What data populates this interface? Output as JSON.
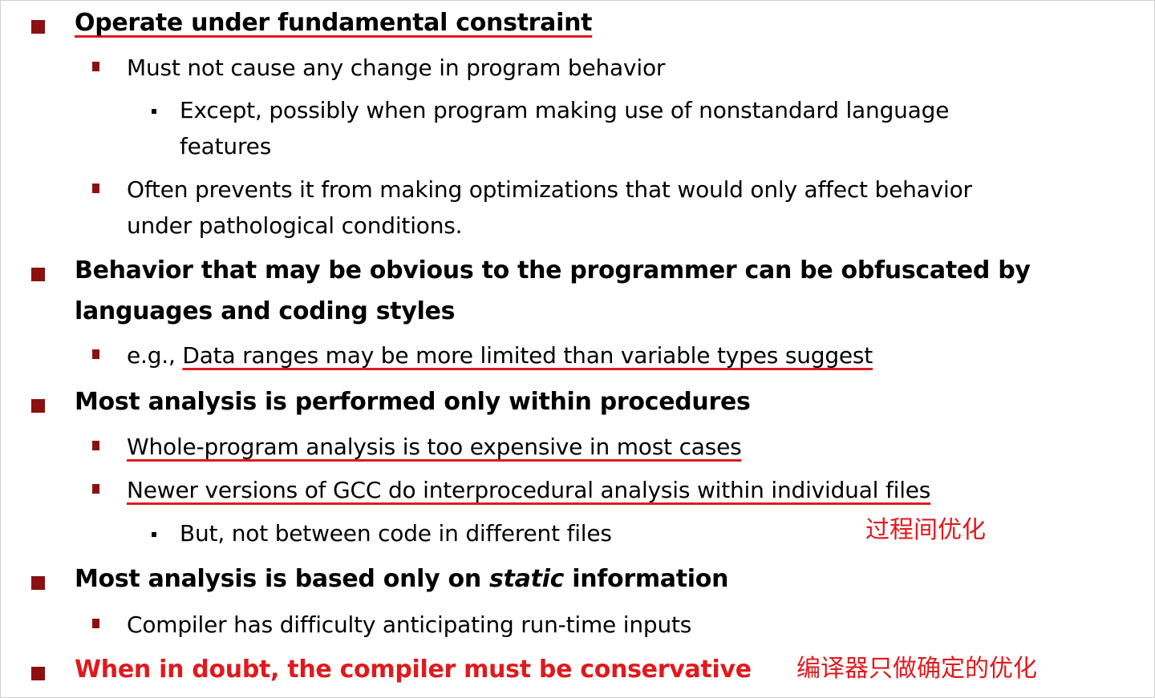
{
  "items": [
    {
      "level": 1,
      "text": "Operate under fundamental constraint"
    },
    {
      "level": 2,
      "text": "Must not cause any change in program behavior"
    },
    {
      "level": 3,
      "text": "Except, possibly when program making use of nonstandard language",
      "cont": "features"
    },
    {
      "level": 2,
      "text": "Often prevents it from making optimizations that would only affect behavior",
      "cont": "under pathological conditions."
    },
    {
      "level": 1,
      "text": "Behavior that may be obvious to the programmer can  be obfuscated by",
      "cont": "languages and coding styles"
    },
    {
      "level": 2,
      "prefix": "e.g., ",
      "text": "Data ranges may be more limited than variable types suggest"
    },
    {
      "level": 1,
      "text": "Most analysis is performed only within procedures"
    },
    {
      "level": 2,
      "text": "Whole-program analysis is too expensive in most cases"
    },
    {
      "level": 2,
      "text": "Newer versions of GCC do interprocedural analysis within individual files"
    },
    {
      "level": 3,
      "text": "But, not between code in different files"
    },
    {
      "level": 1,
      "text_a": "Most analysis is based only on ",
      "text_em": "static",
      "text_b": " information"
    },
    {
      "level": 2,
      "text": "Compiler has difficulty anticipating run-time inputs"
    },
    {
      "level": 1,
      "text": "When in doubt, the compiler must be conservative"
    }
  ],
  "annotations": {
    "interprocedural": "过程间优化",
    "conservative": "编译器只做确定的优化"
  },
  "colors": {
    "bullet": "#8b1010",
    "accent": "#e0191d"
  }
}
